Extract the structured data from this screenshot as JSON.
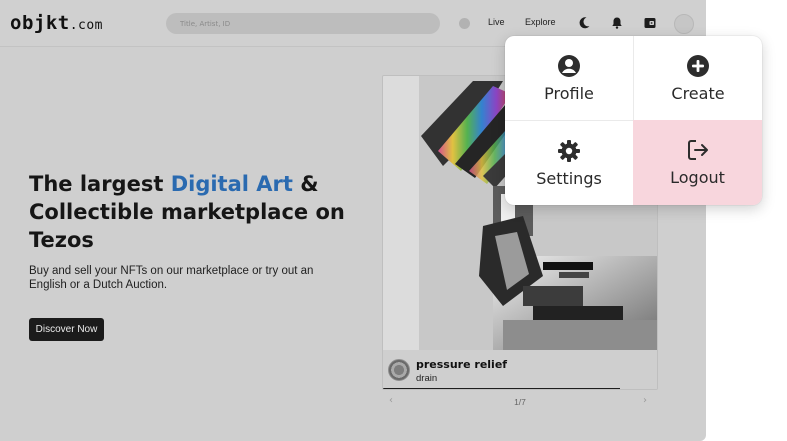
{
  "header": {
    "logo_main": "objkt",
    "logo_suffix": ".com",
    "search_placeholder": "Title, Artist, ID",
    "nav": {
      "live": "Live",
      "explore": "Explore"
    },
    "icons": [
      "status-dot",
      "moon-icon",
      "bell-icon",
      "wallet-icon",
      "avatar"
    ]
  },
  "hero": {
    "title_part1": "The largest ",
    "title_accent": "Digital Art",
    "title_part2": " & Collectible marketplace on Tezos",
    "subtitle": "Buy and sell your NFTs on our marketplace or try out an English or a Dutch Auction.",
    "cta_label": "Discover Now",
    "accent_color": "#2a6ab0"
  },
  "featured": {
    "title": "pressure relief",
    "artist": "drain",
    "pager": "1/7",
    "progress": 0.86
  },
  "user_menu": {
    "profile": "Profile",
    "create": "Create",
    "settings": "Settings",
    "logout": "Logout",
    "logout_highlight": "#f8d6dd"
  }
}
